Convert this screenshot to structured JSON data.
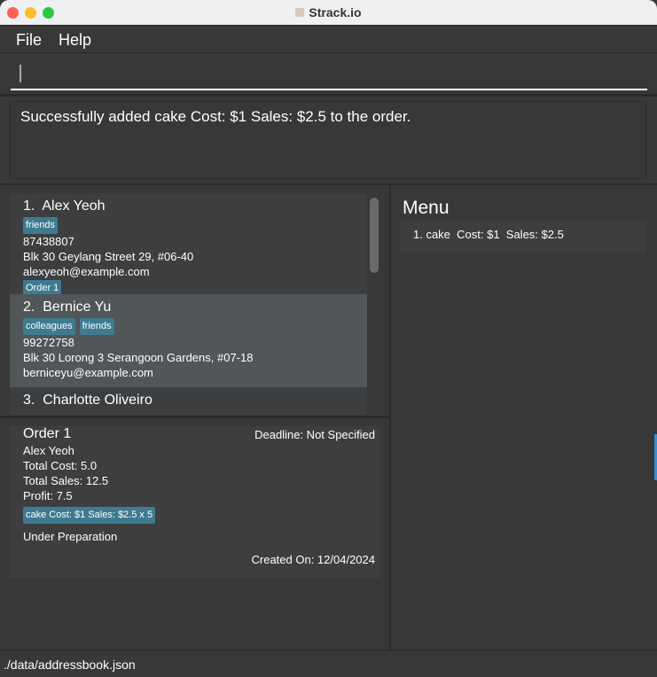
{
  "window": {
    "title": "Strack.io"
  },
  "menubar": {
    "file": "File",
    "help": "Help"
  },
  "command": {
    "value": ""
  },
  "result": {
    "text": "Successfully added cake Cost: $1 Sales: $2.5 to the order."
  },
  "persons": [
    {
      "index": "1.",
      "name": "Alex Yeoh",
      "tags": [
        "friends"
      ],
      "phone": "87438807",
      "address": "Blk 30 Geylang Street 29, #06-40",
      "email": "alexyeoh@example.com",
      "orders": [
        "Order 1"
      ]
    },
    {
      "index": "2.",
      "name": "Bernice Yu",
      "tags": [
        "colleagues",
        "friends"
      ],
      "phone": "99272758",
      "address": "Blk 30 Lorong 3 Serangoon Gardens, #07-18",
      "email": "berniceyu@example.com",
      "orders": []
    },
    {
      "index": "3.",
      "name": "Charlotte Oliveiro"
    }
  ],
  "order": {
    "title": "Order 1",
    "deadline": "Deadline: Not Specified",
    "customer": "Alex Yeoh",
    "total_cost": "Total Cost: 5.0",
    "total_sales": "Total Sales: 12.5",
    "profit": "Profit: 7.5",
    "item": "cake Cost: $1 Sales: $2.5 x 5",
    "status": "Under Preparation",
    "created": "Created On: 12/04/2024"
  },
  "menu": {
    "title": "Menu",
    "items": [
      "1. cake  Cost: $1  Sales: $2.5"
    ]
  },
  "statusbar": {
    "path": "./data/addressbook.json"
  },
  "colors": {
    "background": "#383838",
    "card": "#3c3e40",
    "selected": "#515658",
    "tag": "#3e7b91"
  }
}
